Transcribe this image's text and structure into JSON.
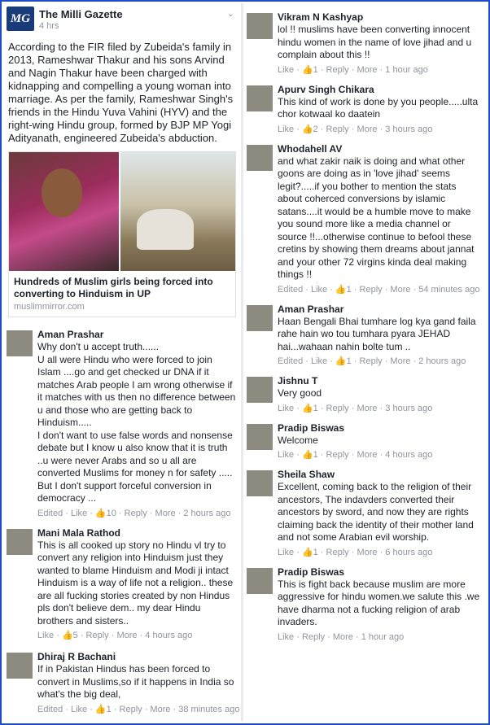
{
  "post": {
    "logo_text": "MG",
    "page_name": "The Milli Gazette",
    "time": "4 hrs",
    "text": "According to the FIR filed by Zubeida's family in 2013, Rameshwar Thakur and his sons Arvind and Nagin Thakur have been charged with kidnapping and compelling a young woman into marriage. As per the family, Rameshwar Singh's friends in the Hindu Yuva Vahini (HYV) and the right-wing Hindu group, formed by BJP MP Yogi Adityanath, engineered Zubeida's abduction.",
    "link_title": "Hundreds of Muslim girls being forced into converting to Hinduism in UP",
    "link_domain": "muslimmirror.com"
  },
  "left_comments": [
    {
      "name": "Aman Prashar",
      "text": "Why don't u accept truth......\nU all were Hindu who were forced to join Islam ....go and get checked ur DNA if it matches Arab people I am wrong otherwise if it matches with us then no difference between u and those who are getting back to Hinduism.....\nI don't want to use false words and nonsense debate but I know u also know that it is truth ..u were never Arabs and so u all are converted Muslims for money n for safety .....\nBut I don't support forceful conversion in democracy ...",
      "actions": "Edited · Like · 👍10 · Reply · More · 2 hours ago"
    },
    {
      "name": "Mani Mala Rathod",
      "text": "This is all cooked up story no Hindu vl try to convert any religion into Hinduism just they wanted to blame Hinduism and Modi ji intact Hinduism is a way of life not a religion.. these are all fucking stories created by non Hindus pls don't believe dem.. my dear Hindu brothers and sisters..",
      "actions": "Like · 👍5 · Reply · More · 4 hours ago"
    },
    {
      "name": "Dhiraj R Bachani",
      "text": "If in Pakistan Hindus has been forced to convert in Muslims,so if it happens in India so what's the big deal,",
      "actions": "Edited · Like · 👍1 · Reply · More · 38 minutes ago"
    }
  ],
  "right_comments": [
    {
      "name": "Vikram N Kashyap",
      "text": "lol !! muslims have been converting innocent hindu women in the name of love jihad and u complain about this !!",
      "actions": "Like · 👍1 · Reply · More · 1 hour ago"
    },
    {
      "name": "Apurv Singh Chikara",
      "text": "This kind of work is done by you people.....ulta chor kotwaal ko daatein",
      "actions": "Like · 👍2 · Reply · More · 3 hours ago"
    },
    {
      "name": "Whodahell AV",
      "text": "and what zakir naik is doing and what other goons are doing as in 'love jihad' seems legit?.....if you bother to mention the stats about coherced conversions by islamic satans....it would be a humble move to make you sound more like a media channel or source !!...otherwise continue to befool these cretins by showing them dreams about jannat and your other 72 virgins kinda deal making things !!",
      "actions": "Edited · Like · 👍1 · Reply · More · 54 minutes ago"
    },
    {
      "name": "Aman Prashar",
      "text": "Haan Bengali Bhai tumhare log kya gand faila rahe hain wo tou tumhara pyara JEHAD hai...wahaan nahin bolte tum ..",
      "actions": "Edited · Like · 👍1 · Reply · More · 2 hours ago"
    },
    {
      "name": "Jishnu T",
      "text": "Very good",
      "actions": "Like · 👍1 · Reply · More · 3 hours ago"
    },
    {
      "name": "Pradip Biswas",
      "text": "Welcome",
      "actions": "Like · 👍1 · Reply · More · 4 hours ago"
    },
    {
      "name": "Sheila Shaw",
      "text": "Excellent, coming back to the religion of their ancestors, The indavders converted their ancestors by sword, and now they are rights claiming back the identity of their mother land and not some Arabian evil worship.",
      "actions": "Like · 👍1 · Reply · More · 6 hours ago"
    },
    {
      "name": "Pradip Biswas",
      "text": "This is fight back because muslim are more aggressive for hindu women.we salute this .we have dharma not a fucking religion of arab invaders.",
      "actions": "Like · Reply · More · 1 hour ago"
    }
  ]
}
